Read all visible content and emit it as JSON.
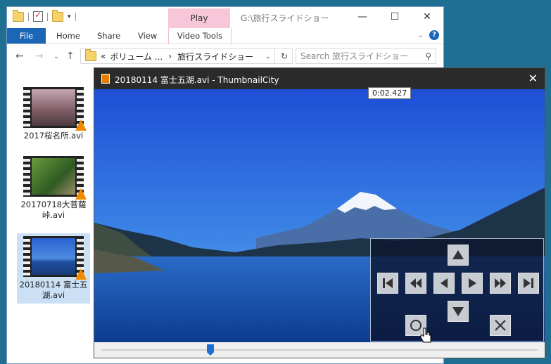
{
  "explorer": {
    "contextual_tab_label": "Play",
    "window_title": "G:\\旅行スライドショー",
    "ribbon_tabs": [
      "File",
      "Home",
      "Share",
      "View",
      "Video Tools"
    ],
    "address": {
      "overflow": "«",
      "crumb1": "ボリューム ...",
      "sep": "›",
      "crumb2": "旅行スライドショー"
    },
    "search_placeholder": "Search 旅行スライドショー",
    "files": [
      {
        "name": "2017桜名所.avi"
      },
      {
        "name": "20170718大菩薩峠.avi"
      },
      {
        "name": "20180114 富士五湖.avi",
        "selected": true
      }
    ]
  },
  "thumbnailcity": {
    "title": "20180114 富士五湖.avi - ThumbnailCity",
    "time_tooltip": "0:02.427",
    "seek_position_fraction": 0.25
  },
  "icons": {
    "qat": [
      "folder-icon",
      "properties-check-icon",
      "new-folder-icon",
      "qat-dropdown-icon"
    ],
    "controls": [
      "up-arrow-icon",
      "skip-first-icon",
      "rewind-icon",
      "step-back-icon",
      "play-icon",
      "fast-forward-icon",
      "skip-last-icon",
      "down-arrow-icon",
      "record-circle-icon",
      "close-x-icon"
    ]
  },
  "colors": {
    "desktop": "#1f6f93",
    "file_tab": "#1c66b8",
    "context_tab": "#f7c7d9",
    "selection": "#cce0f5",
    "seek_thumb": "#1e6fd0"
  }
}
